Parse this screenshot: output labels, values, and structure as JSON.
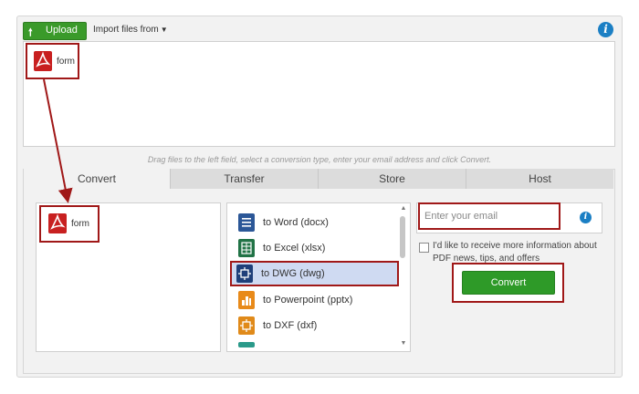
{
  "toolbar": {
    "upload_label": "Upload",
    "upload_arrow": "🠕",
    "import_label": "Import files from",
    "import_caret": "▼",
    "info_glyph": "i"
  },
  "top_drop": {
    "files": [
      {
        "name": "form",
        "icon": "pdf-icon"
      }
    ]
  },
  "hint": "Drag files to the left field, select a conversion type, enter your email address and click Convert.",
  "tabs": [
    {
      "label": "Convert",
      "active": true
    },
    {
      "label": "Transfer",
      "active": false
    },
    {
      "label": "Store",
      "active": false
    },
    {
      "label": "Host",
      "active": false
    }
  ],
  "left_field": {
    "files": [
      {
        "name": "form",
        "icon": "pdf-icon"
      }
    ]
  },
  "conversions": [
    {
      "label": "to Word (docx)",
      "icon": "word-doc-icon",
      "color": "#2b5797",
      "selected": false
    },
    {
      "label": "to Excel (xlsx)",
      "icon": "excel-sheet-icon",
      "color": "#217346",
      "selected": false
    },
    {
      "label": "to DWG (dwg)",
      "icon": "dwg-drawing-icon",
      "color": "#1f3f7a",
      "selected": true
    },
    {
      "label": "to Powerpoint (pptx)",
      "icon": "powerpoint-chart-icon",
      "color": "#e88a1a",
      "selected": false
    },
    {
      "label": "to DXF (dxf)",
      "icon": "dxf-drawing-icon",
      "color": "#e08a1a",
      "selected": false
    }
  ],
  "email": {
    "placeholder": "Enter your email",
    "value": ""
  },
  "newsletter": {
    "label": "I'd like to receive more information about PDF news, tips, and offers",
    "checked": false
  },
  "convert_button": "Convert",
  "colors": {
    "accent_green": "#3a9a2a",
    "highlight_red": "#a01818",
    "info_blue": "#1b7fc4",
    "pdf_red": "#c82020",
    "selected_bg": "#cfdaf2"
  }
}
